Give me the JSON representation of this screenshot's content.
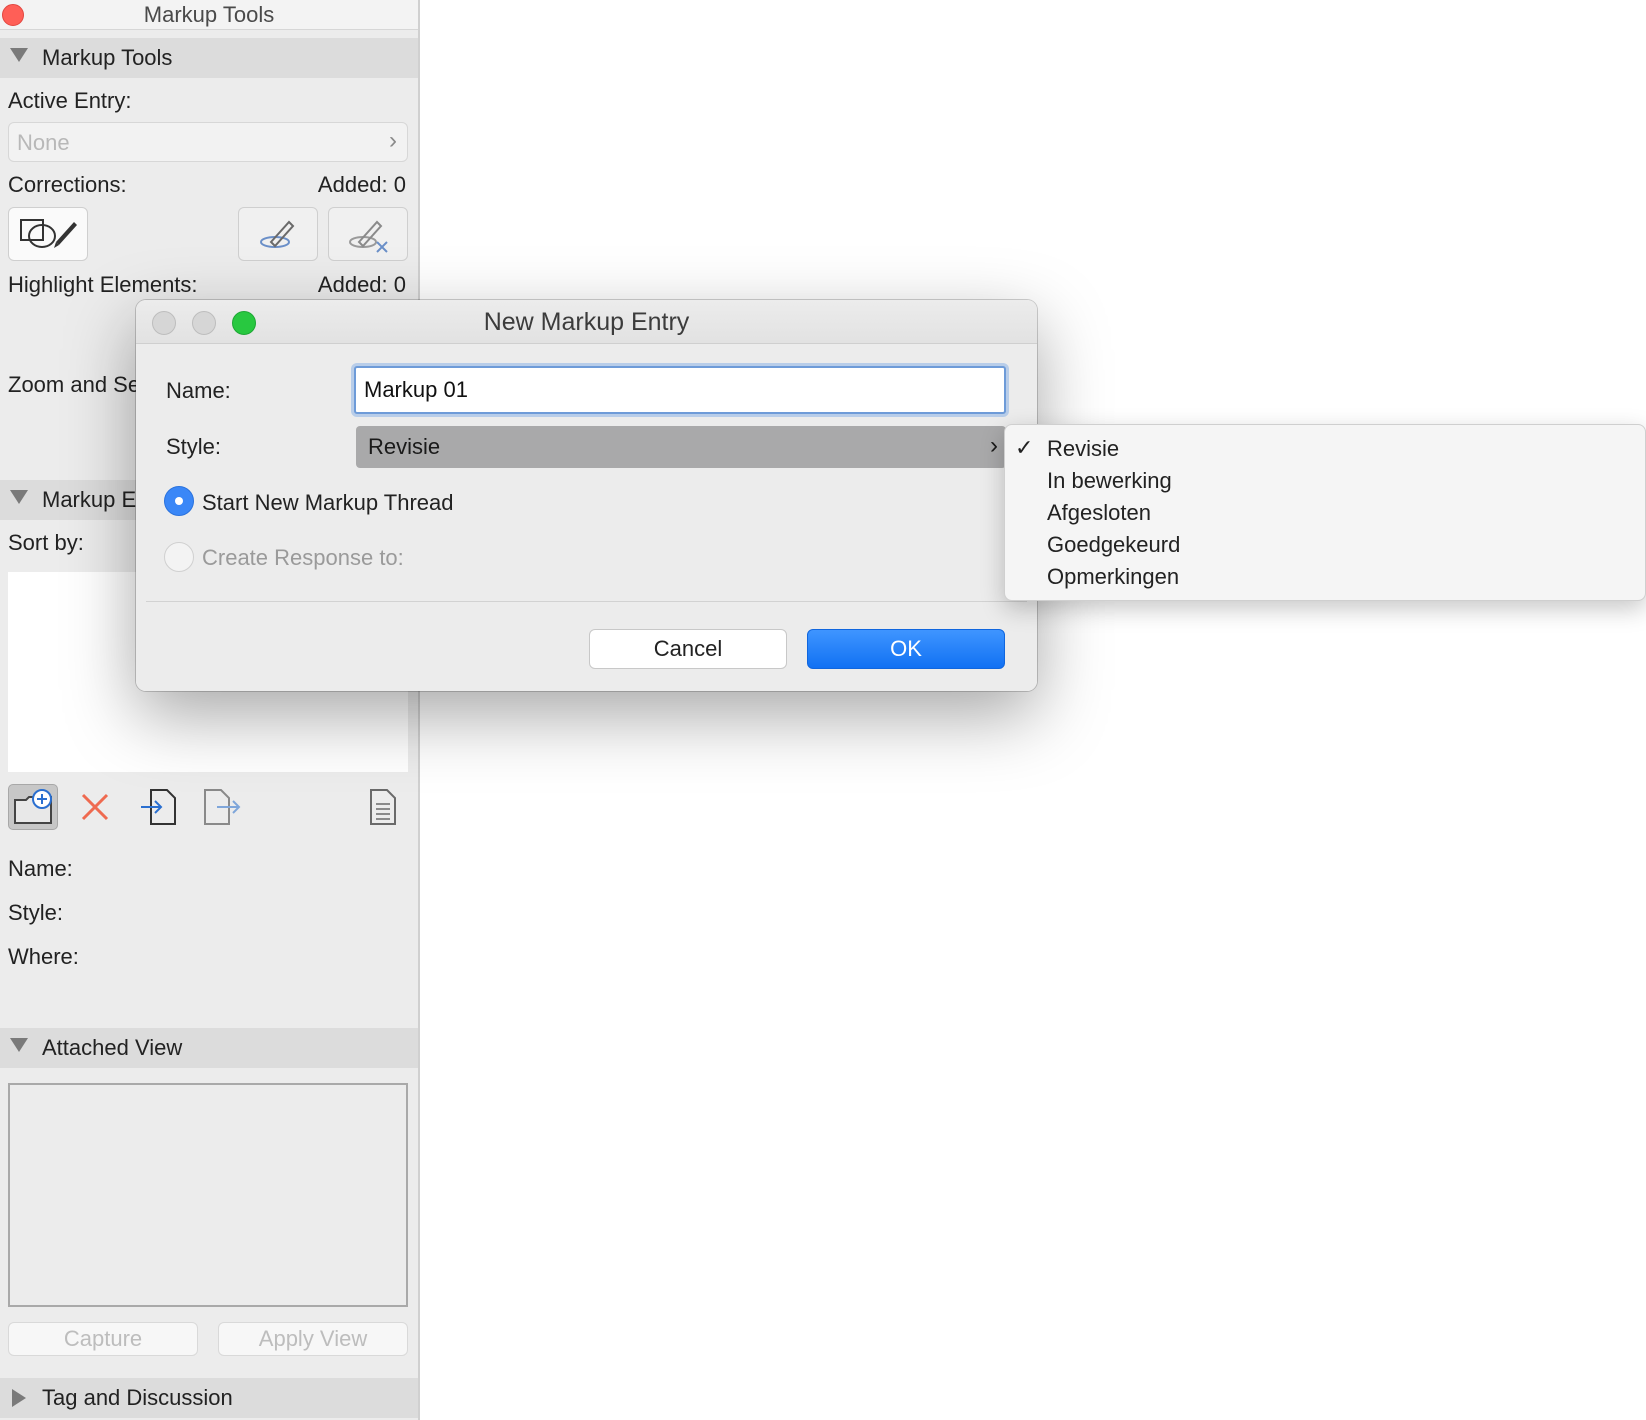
{
  "panel": {
    "title": "Markup Tools",
    "section_markup_tools": "Markup Tools",
    "active_entry_label": "Active Entry:",
    "active_entry_value": "None",
    "corrections_label": "Corrections:",
    "corrections_added": "Added: 0",
    "highlight_label": "Highlight Elements:",
    "highlight_added": "Added: 0",
    "zoom_label": "Zoom and Se",
    "section_markup_entries": "Markup E",
    "sort_by_label": "Sort by:",
    "name_label": "Name:",
    "style_label": "Style:",
    "where_label": "Where:",
    "section_attached_view": "Attached View",
    "capture_button": "Capture",
    "apply_view_button": "Apply View",
    "section_tag_discussion": "Tag and Discussion"
  },
  "dialog": {
    "title": "New Markup Entry",
    "name_label": "Name:",
    "name_value": "Markup 01",
    "style_label": "Style:",
    "style_value": "Revisie",
    "radio_new_thread": "Start New Markup Thread",
    "radio_response": "Create Response to:",
    "cancel_button": "Cancel",
    "ok_button": "OK"
  },
  "style_menu": {
    "items": [
      {
        "label": "Revisie",
        "checked": "✓"
      },
      {
        "label": "In bewerking",
        "checked": ""
      },
      {
        "label": "Afgesloten",
        "checked": ""
      },
      {
        "label": "Goedgekeurd",
        "checked": ""
      },
      {
        "label": "Opmerkingen",
        "checked": ""
      }
    ]
  },
  "colors": {
    "accent": "#1171f3",
    "close_red": "#ff5f57",
    "zoom_green": "#28c840",
    "delete_red": "#ef6a50"
  },
  "icons": [
    "correction-markup-icon",
    "add-correction-icon",
    "remove-correction-icon",
    "new-entry-icon",
    "delete-icon",
    "import-icon",
    "export-icon",
    "report-icon",
    "checkmark-icon",
    "chevron-right-icon",
    "disclosure-triangle-icon"
  ]
}
